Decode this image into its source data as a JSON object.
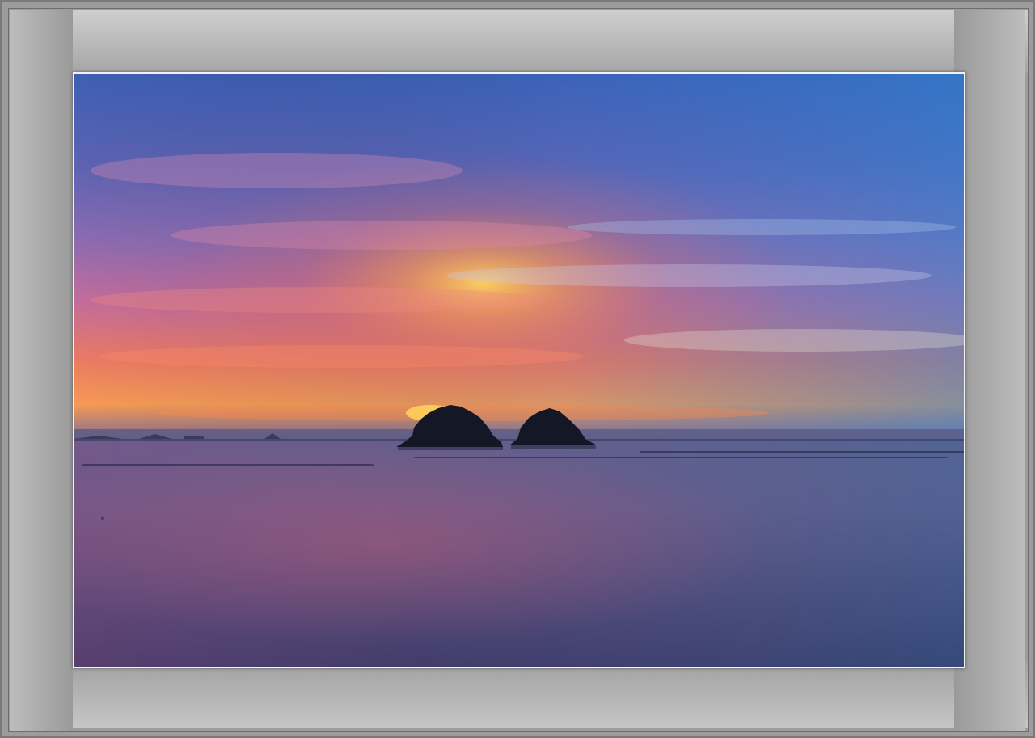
{
  "image": {
    "subject": "sunset-over-sea-with-two-islets",
    "colors": {
      "sky_top": "#3f62b8",
      "sky_mid": "#8a6fb0",
      "glow": "#f08a4a",
      "sun": "#ffc45a",
      "sea": "#4a5a8a",
      "frame": "#9c9c9c"
    }
  }
}
